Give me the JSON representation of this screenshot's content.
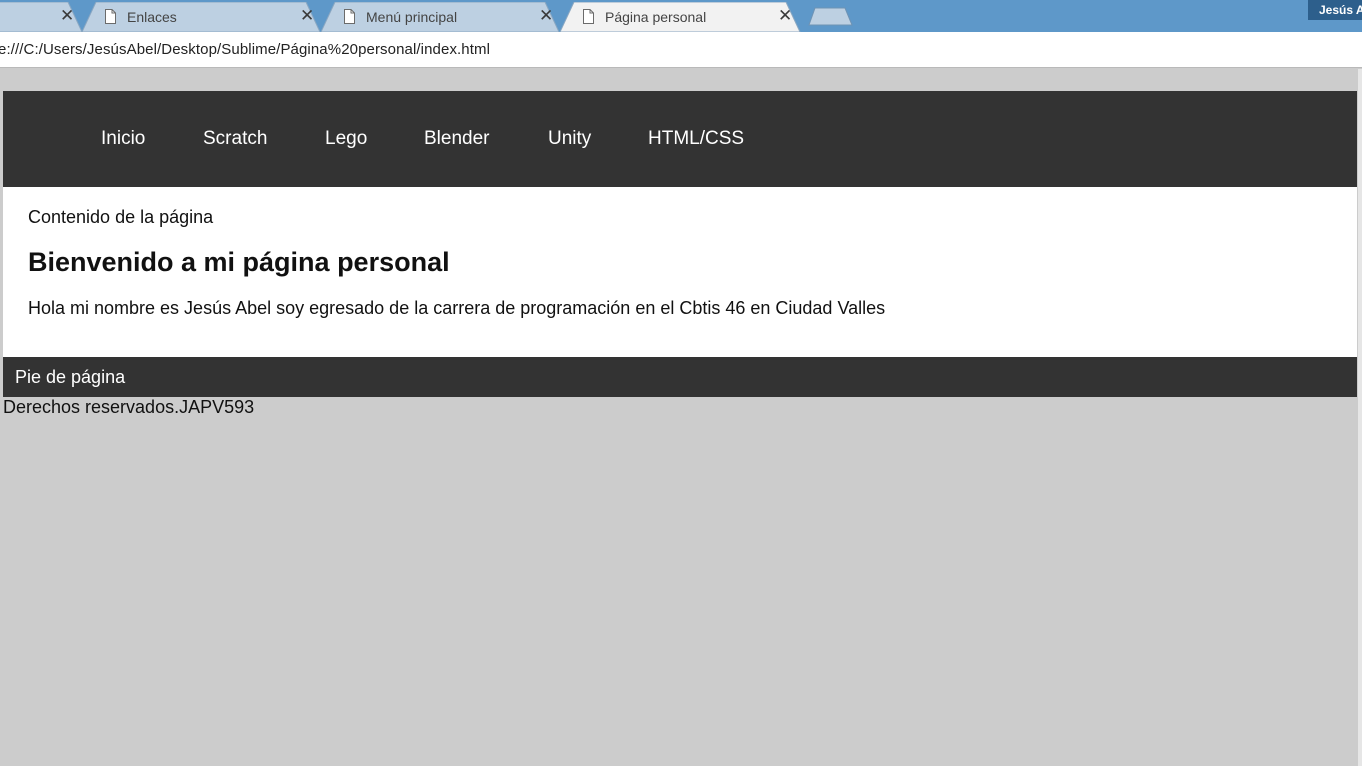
{
  "browser": {
    "tabs": [
      {
        "title": "",
        "close": "✕",
        "active": false
      },
      {
        "title": "Enlaces",
        "close": "✕",
        "active": false
      },
      {
        "title": "Menú principal",
        "close": "✕",
        "active": false
      },
      {
        "title": "Página personal",
        "close": "✕",
        "active": true
      }
    ],
    "profile_name": "Jesús A",
    "address": "e:///C:/Users/JesúsAbel/Desktop/Sublime/Página%20personal/index.html",
    "colors": {
      "tabstrip": "#5e98c9",
      "inactive_tab": "#bdd0e2",
      "active_tab": "#f2f2f2"
    }
  },
  "page": {
    "nav": {
      "items": [
        {
          "label": "Inicio"
        },
        {
          "label": "Scratch"
        },
        {
          "label": "Lego"
        },
        {
          "label": "Blender"
        },
        {
          "label": "Unity"
        },
        {
          "label": "HTML/CSS"
        }
      ]
    },
    "content": {
      "label": "Contenido de la página",
      "heading": "Bienvenido a mi página personal",
      "text": "Hola mi nombre es Jesús Abel soy egresado de la carrera de programación en el Cbtis 46 en Ciudad Valles"
    },
    "footer": {
      "label": "Pie de página",
      "copyright": "Derechos reservados.JAPV593"
    },
    "colors": {
      "background": "#cccccc",
      "nav": "#333333",
      "footer": "#333333",
      "content": "#ffffff"
    }
  }
}
